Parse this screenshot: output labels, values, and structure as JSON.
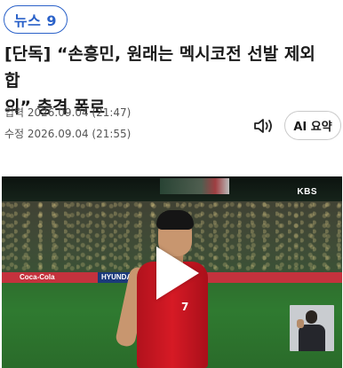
{
  "badge": {
    "label": "뉴스 9"
  },
  "article": {
    "headline_line1": "[단독] “손흥민, 원래는 멕시코전 선발 제외 합",
    "headline_line2": "의” 충격 폭로",
    "published": "입력 2026.09.04 (21:47)",
    "edited": "수정 2026.09.04 (21:55)"
  },
  "actions": {
    "ai_summary_label": "AI 요약",
    "speaker_icon": "speaker-icon"
  },
  "video": {
    "channel_logo": "KBS",
    "ads": [
      "Coca-Cola",
      "HYUNDAI"
    ],
    "jersey_number": "7",
    "play_icon": "play-icon",
    "sign_language_icon": "sign-language-interpreter"
  },
  "colors": {
    "accent": "#2b62c9",
    "jersey": "#d61a25"
  }
}
